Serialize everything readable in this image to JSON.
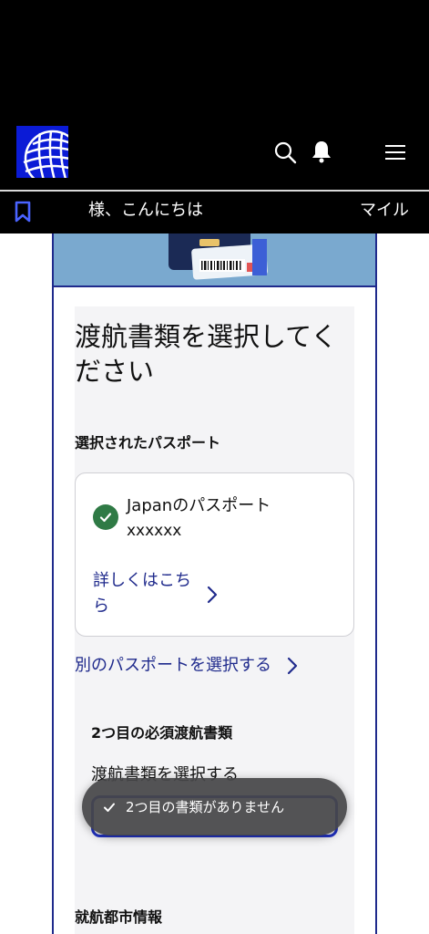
{
  "header": {
    "logo_name": "united-globe-logo",
    "icons": {
      "search": "search-icon",
      "notifications": "bell-icon",
      "menu": "hamburger-menu-icon"
    }
  },
  "greeting_bar": {
    "greeting": "様、こんにちは",
    "miles_label": "マイル",
    "bookmark_icon": "bookmark-icon"
  },
  "main": {
    "title": "渡航書類を選択してください",
    "selected_passport_heading": "選択されたパスポート",
    "passport": {
      "name": "Japanのパスポート",
      "number": "xxxxxx",
      "details_link": "詳しくはこちら"
    },
    "choose_other_passport_link": "別のパスポートを選択する",
    "second_required_doc_heading": "2つ目の必須渡航書類",
    "select_doc_label": "渡航書類を選択する",
    "city_info_heading": "就航都市情報"
  },
  "toast": {
    "message": "2つ目の書類がありません"
  },
  "colors": {
    "brand_blue": "#1f2a8c",
    "accent_blue": "#2233c9",
    "success_green": "#2f7a45",
    "hero_blue": "#7aa9cf"
  }
}
